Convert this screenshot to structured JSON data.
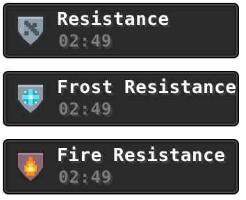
{
  "effects": [
    {
      "name": "Resistance",
      "timer": "02:49",
      "icon": "resistance-shield-icon",
      "colors": {
        "shield": "#8e9aa6",
        "emblem": "#4a5866"
      }
    },
    {
      "name": "Frost Resistance",
      "timer": "02:49",
      "icon": "frost-resistance-shield-icon",
      "colors": {
        "shield": "#8e9aa6",
        "emblem": "#5fe6f0"
      }
    },
    {
      "name": "Fire Resistance",
      "timer": "02:49",
      "icon": "fire-resistance-shield-icon",
      "colors": {
        "shield": "#8a6a72",
        "emblem": "#ffb020"
      }
    }
  ],
  "theme": {
    "panel_bg": "#2a2a2a",
    "name_color": "#ffffff",
    "timer_color": "#7c7c7c"
  }
}
